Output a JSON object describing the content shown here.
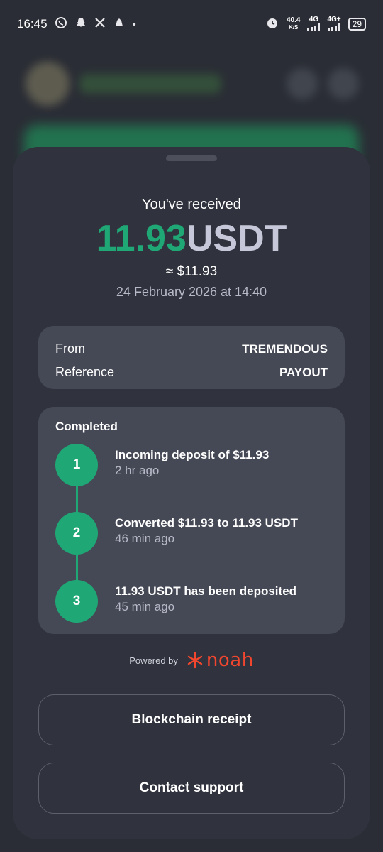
{
  "status_bar": {
    "time": "16:45",
    "net_speed_value": "40.4",
    "net_speed_unit": "K/S",
    "signal_1": "4G",
    "signal_2": "4G+",
    "battery": "29"
  },
  "receipt": {
    "title": "You've received",
    "amount": "11.93",
    "currency": "USDT",
    "approx": "≈ $11.93",
    "date": "24 February 2026 at 14:40"
  },
  "details": {
    "from_label": "From",
    "from_value": "TREMENDOUS",
    "reference_label": "Reference",
    "reference_value": "PAYOUT"
  },
  "steps": {
    "title": "Completed",
    "items": [
      {
        "number": "1",
        "title": "Incoming deposit of $11.93",
        "time": "2 hr ago"
      },
      {
        "number": "2",
        "title": "Converted $11.93 to 11.93 USDT",
        "time": "46 min ago"
      },
      {
        "number": "3",
        "title": "11.93 USDT has been deposited",
        "time": "45 min ago"
      }
    ]
  },
  "powered_by": {
    "label": "Powered by",
    "brand": "noah"
  },
  "actions": {
    "receipt_label": "Blockchain receipt",
    "support_label": "Contact support"
  },
  "colors": {
    "accent_green": "#1fa876",
    "brand_red": "#f2462e",
    "sheet_bg": "#30333d",
    "card_bg": "#454855"
  }
}
